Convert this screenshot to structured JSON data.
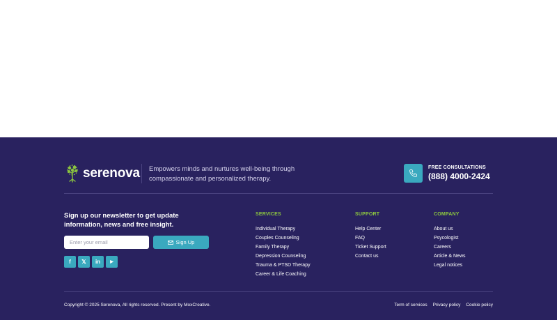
{
  "brand": {
    "name": "serenova",
    "tagline": "Empowers minds and nurtures well-being through compassionate and personalized therapy."
  },
  "consultation": {
    "label": "FREE CONSULTATIONS",
    "phone": "(888) 4000-2424"
  },
  "newsletter": {
    "heading": "Sign up our newsletter to get update information, news and free insight.",
    "email_placeholder": "Enter your email",
    "email_value": "",
    "signup_label": "Sign Up"
  },
  "socials": [
    {
      "icon": "facebook-icon",
      "glyph": "f"
    },
    {
      "icon": "x-icon",
      "glyph": "𝕏"
    },
    {
      "icon": "linkedin-icon",
      "glyph": "in"
    },
    {
      "icon": "youtube-icon",
      "glyph": "▶"
    }
  ],
  "columns": {
    "services": {
      "title": "SERVICES",
      "items": [
        "Individual Therapy",
        "Couples Counseling",
        "Family Therapy",
        "Depression Counseling",
        "Trauma & PTSD Therapy",
        "Career & Life Coaching"
      ]
    },
    "support": {
      "title": "SUPPORT",
      "items": [
        "Help Center",
        "FAQ",
        "Ticket Support",
        "Contact us"
      ]
    },
    "company": {
      "title": "COMPANY",
      "items": [
        "About us",
        "Psycologist",
        "Careers",
        "Article & News",
        "Legal notices"
      ]
    }
  },
  "bottom": {
    "copyright": "Copyright © 2025 Serenova, All rights reserved. Present by MoxCreative.",
    "links": [
      "Term of services",
      "Privacy policy",
      "Cookie policy"
    ]
  },
  "colors": {
    "footer_bg": "#29225f",
    "accent": "#3aa9bf",
    "column_title": "#8cc63f"
  }
}
